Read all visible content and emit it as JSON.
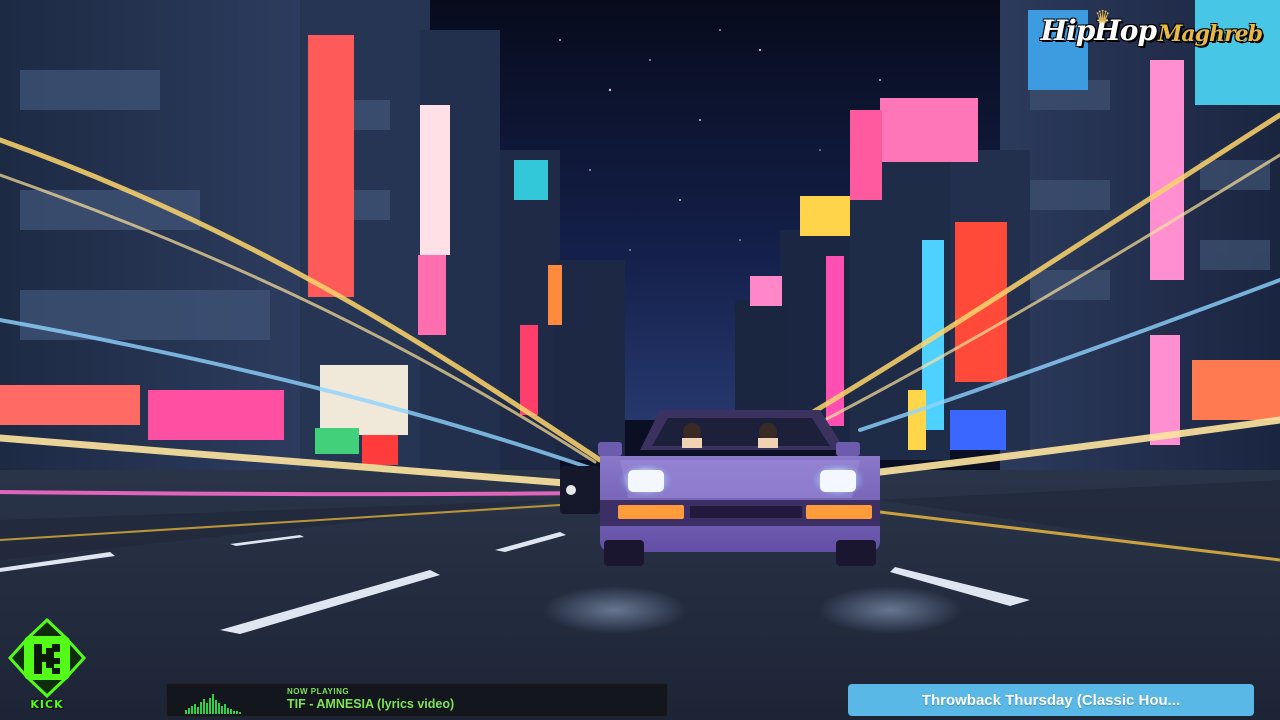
{
  "brand": {
    "logo_part_1": "HipHop",
    "logo_part_2": "Maghreb"
  },
  "platform_badge": {
    "label": "KICK",
    "letter": "K",
    "color": "#53fc18"
  },
  "now_playing": {
    "label": "NOW PLAYING",
    "track": "TIF - AMNESIA (lyrics video)",
    "accent_color": "#7fe35a"
  },
  "stream_title": {
    "text": "Throwback Thursday (Classic Hou...",
    "color": "#59b8e6"
  },
  "scene": {
    "type": "anime-night-city-drive"
  }
}
